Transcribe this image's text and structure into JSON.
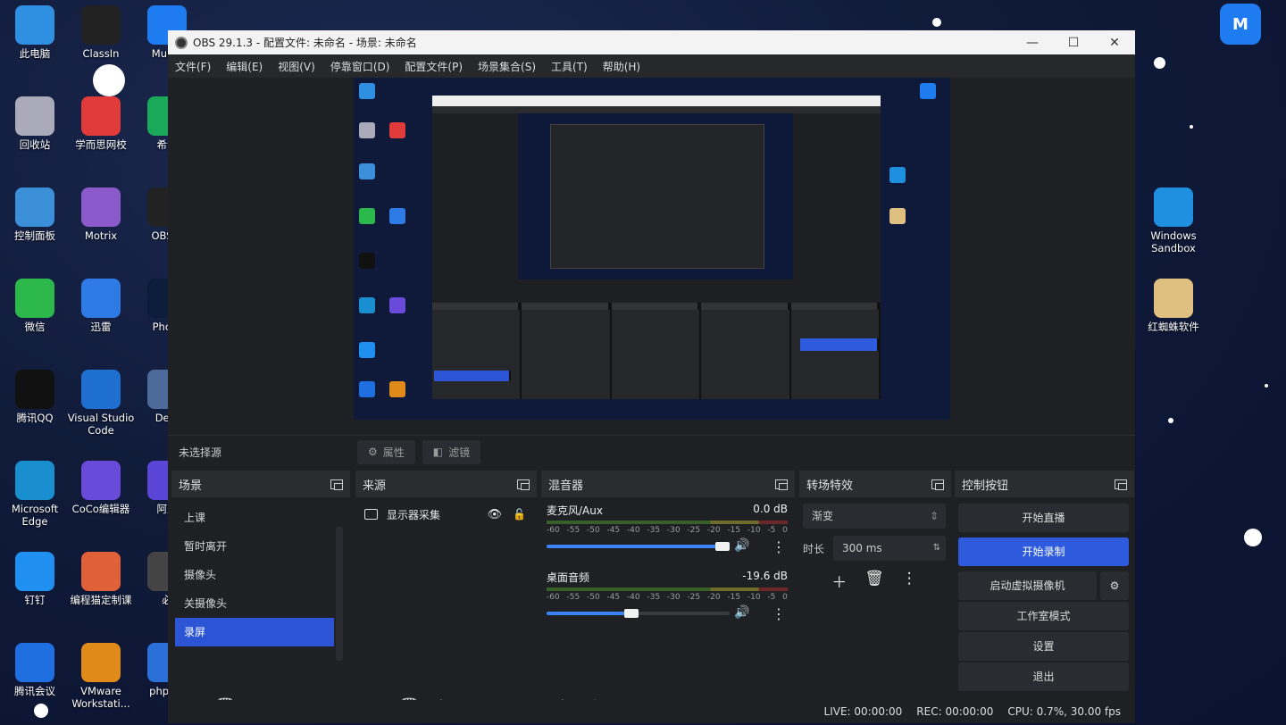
{
  "desktop": {
    "left_icons": [
      {
        "label": "此电脑",
        "color": "#2f8fe0"
      },
      {
        "label": "ClassIn",
        "color": "#222"
      },
      {
        "label": "MuMu",
        "color": "#1f7cf0"
      },
      {
        "label": "回收站",
        "color": "#aab"
      },
      {
        "label": "学而思网校",
        "color": "#e03a3a"
      },
      {
        "label": "希沃",
        "color": "#1aa85a"
      },
      {
        "label": "控制面板",
        "color": "#3a8fd8"
      },
      {
        "label": "Motrix",
        "color": "#8a5acb"
      },
      {
        "label": "OBS S",
        "color": "#222"
      },
      {
        "label": "微信",
        "color": "#2db84b"
      },
      {
        "label": "迅雷",
        "color": "#2e7be6"
      },
      {
        "label": "Photo",
        "color": "#0b1d3a"
      },
      {
        "label": "腾讯QQ",
        "color": "#111"
      },
      {
        "label": "Visual Studio Code",
        "color": "#1f6fd0"
      },
      {
        "label": "Dev-",
        "color": "#4d6b9a"
      },
      {
        "label": "Microsoft Edge",
        "color": "#1a8fd0"
      },
      {
        "label": "CoCo编辑器",
        "color": "#6a4ad8"
      },
      {
        "label": "阿里",
        "color": "#5b45d6"
      },
      {
        "label": "钉钉",
        "color": "#1f8ff0"
      },
      {
        "label": "编程猫定制课",
        "color": "#e0603a"
      },
      {
        "label": "必",
        "color": "#444"
      },
      {
        "label": "腾讯会议",
        "color": "#1f6fe0"
      },
      {
        "label": "VMware Workstati...",
        "color": "#e08a1a"
      },
      {
        "label": "phpstu",
        "color": "#2b6fd8"
      }
    ],
    "right_icons": [
      {
        "label": "Windows Sandbox",
        "color": "#1f8fe0"
      },
      {
        "label": "红蜘蛛软件",
        "color": "#e0c080"
      }
    ]
  },
  "obs": {
    "title": "OBS 29.1.3 - 配置文件: 未命名 - 场景: 未命名",
    "menu": [
      "文件(F)",
      "编辑(E)",
      "视图(V)",
      "停靠窗口(D)",
      "配置文件(P)",
      "场景集合(S)",
      "工具(T)",
      "帮助(H)"
    ],
    "context": {
      "no_source": "未选择源",
      "properties": "属性",
      "filters": "滤镜"
    },
    "scenes": {
      "title": "场景",
      "items": [
        "上课",
        "暂时离开",
        "摄像头",
        "关摄像头",
        "录屏"
      ],
      "selected_index": 4
    },
    "sources": {
      "title": "来源",
      "items": [
        {
          "label": "显示器采集"
        }
      ]
    },
    "mixer": {
      "title": "混音器",
      "channels": [
        {
          "name": "麦克风/Aux",
          "db": "0.0 dB",
          "volume": 1.0
        },
        {
          "name": "桌面音频",
          "db": "-19.6 dB",
          "volume": 0.5
        }
      ],
      "ticks": [
        "-60",
        "-55",
        "-50",
        "-45",
        "-40",
        "-35",
        "-30",
        "-25",
        "-20",
        "-15",
        "-10",
        "-5",
        "0"
      ]
    },
    "transitions": {
      "title": "转场特效",
      "type": "渐变",
      "duration_label": "时长",
      "duration": "300 ms"
    },
    "controls": {
      "title": "控制按钮",
      "start_stream": "开始直播",
      "start_record": "开始录制",
      "virtual_cam": "启动虚拟摄像机",
      "studio_mode": "工作室模式",
      "settings": "设置",
      "exit": "退出"
    },
    "status": {
      "live": "LIVE: 00:00:00",
      "rec": "REC: 00:00:00",
      "cpu": "CPU: 0.7%, 30.00 fps"
    }
  }
}
